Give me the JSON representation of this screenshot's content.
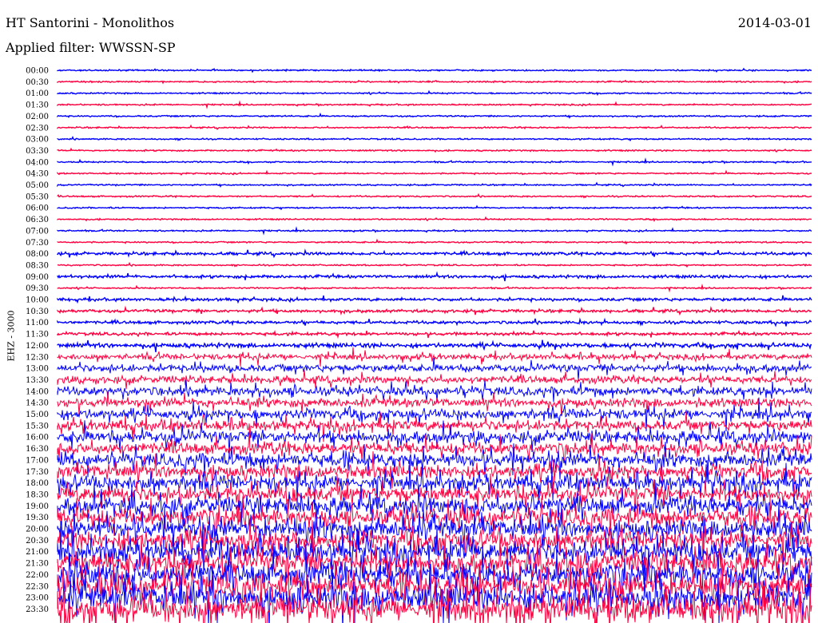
{
  "header": {
    "station": "HT Santorini - Monolithos",
    "date": "2014-03-01",
    "filter": "Applied filter: WWSSN-SP"
  },
  "channel_label": "EHZ - 3000",
  "colors": {
    "even_trace": "#0000ff",
    "odd_trace": "#ff0040",
    "background": "#ffffff"
  },
  "chart_data": {
    "type": "line",
    "title": "HT Santorini - Monolithos",
    "subtitle": "Applied filter: WWSSN-SP",
    "ylabel": "EHZ - 3000",
    "xlabel": "",
    "row_interval_minutes": 30,
    "trace_colors_alternate": [
      "#0000ff",
      "#ff0040"
    ],
    "categories": [
      "00:00",
      "00:30",
      "01:00",
      "01:30",
      "02:00",
      "02:30",
      "03:00",
      "03:30",
      "04:00",
      "04:30",
      "05:00",
      "05:30",
      "06:00",
      "06:30",
      "07:00",
      "07:30",
      "08:00",
      "08:30",
      "09:00",
      "09:30",
      "10:00",
      "10:30",
      "11:00",
      "11:30",
      "12:00",
      "12:30",
      "13:00",
      "13:30",
      "14:00",
      "14:30",
      "15:00",
      "15:30",
      "16:00",
      "16:30",
      "17:00",
      "17:30",
      "18:00",
      "18:30",
      "19:00",
      "19:30",
      "20:00",
      "20:30",
      "21:00",
      "21:30",
      "22:00",
      "22:30",
      "23:00",
      "23:30"
    ],
    "values": [
      1,
      1,
      1,
      1,
      1,
      1,
      1,
      1,
      1,
      1,
      1,
      1,
      1,
      1,
      1,
      1,
      2,
      1,
      2,
      1,
      2,
      2,
      2,
      2,
      3,
      4,
      5,
      5,
      6,
      6,
      7,
      7,
      8,
      8,
      9,
      9,
      10,
      10,
      11,
      11,
      12,
      12,
      13,
      13,
      14,
      14,
      15,
      15
    ],
    "grid": false,
    "legend": "none"
  }
}
